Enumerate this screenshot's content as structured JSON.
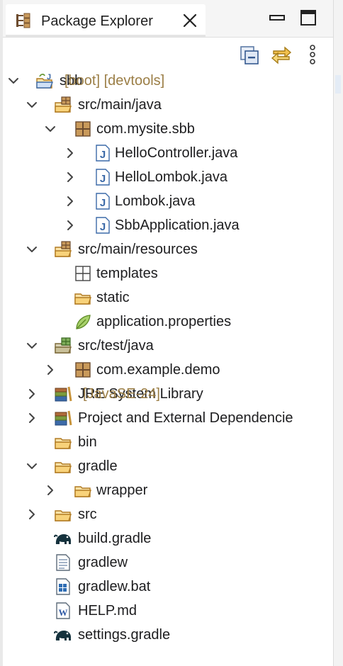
{
  "view": {
    "tab_title": "Package Explorer",
    "icons": {
      "tab": "package-explorer-icon",
      "close": "close-icon",
      "minimize": "minimize-icon",
      "maximize": "maximize-icon",
      "collapse_all": "collapse-all-icon",
      "link_with_editor": "link-with-editor-icon",
      "view_menu": "kebab-menu-icon"
    }
  },
  "tree": [
    {
      "label": "sbb",
      "decoration": "[boot] [devtools]",
      "expanded": true,
      "icon": "project-icon"
    },
    {
      "label": "src/main/java",
      "expanded": true,
      "icon": "source-folder-icon"
    },
    {
      "label": "com.mysite.sbb",
      "expanded": true,
      "icon": "package-icon"
    },
    {
      "label": "HelloController.java",
      "expanded": false,
      "icon": "java-file-icon"
    },
    {
      "label": "HelloLombok.java",
      "expanded": false,
      "icon": "java-file-icon"
    },
    {
      "label": "Lombok.java",
      "expanded": false,
      "icon": "java-file-icon"
    },
    {
      "label": "SbbApplication.java",
      "expanded": false,
      "icon": "java-file-icon"
    },
    {
      "label": "src/main/resources",
      "expanded": true,
      "icon": "source-folder-icon"
    },
    {
      "label": "templates",
      "icon": "empty-package-icon"
    },
    {
      "label": "static",
      "icon": "folder-icon"
    },
    {
      "label": "application.properties",
      "icon": "properties-file-icon"
    },
    {
      "label": "src/test/java",
      "expanded": true,
      "icon": "test-source-folder-icon"
    },
    {
      "label": "com.example.demo",
      "expanded": false,
      "icon": "package-icon"
    },
    {
      "label": "JRE System Library",
      "decoration": "[JavaSE-24]",
      "expanded": false,
      "icon": "library-icon"
    },
    {
      "label": "Project and External Dependencie",
      "expanded": false,
      "icon": "library-icon"
    },
    {
      "label": "bin",
      "icon": "folder-icon"
    },
    {
      "label": "gradle",
      "expanded": true,
      "icon": "folder-icon"
    },
    {
      "label": "wrapper",
      "expanded": false,
      "icon": "folder-icon"
    },
    {
      "label": "src",
      "expanded": false,
      "icon": "folder-icon"
    },
    {
      "label": "build.gradle",
      "icon": "gradle-elephant-icon"
    },
    {
      "label": "gradlew",
      "icon": "text-file-icon"
    },
    {
      "label": "gradlew.bat",
      "icon": "windows-batch-file-icon"
    },
    {
      "label": "HELP.md",
      "icon": "word-document-icon"
    },
    {
      "label": "settings.gradle",
      "icon": "gradle-elephant-icon"
    }
  ]
}
